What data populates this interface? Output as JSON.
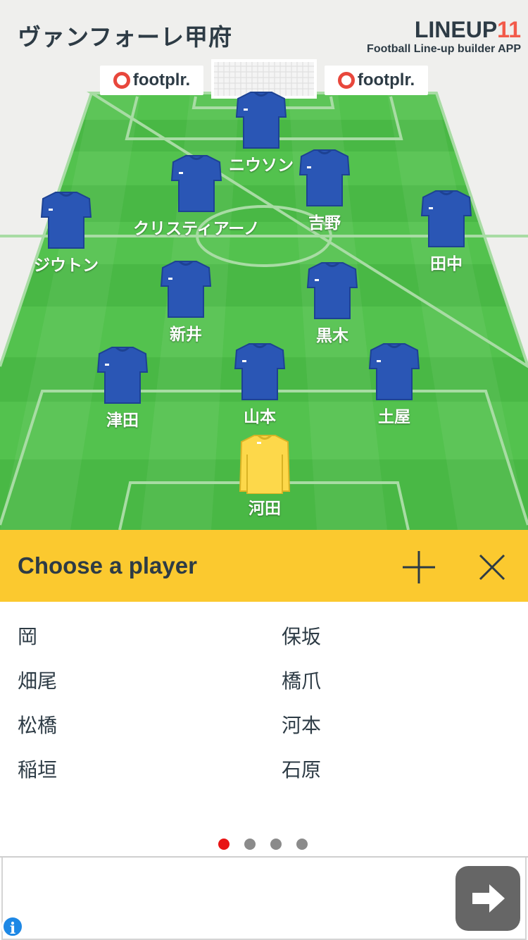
{
  "header": {
    "team_name": "ヴァンフォーレ甲府",
    "brand_logo": "LINEUP",
    "brand_logo_num": "11",
    "brand_sub": "Football Line-up builder APP"
  },
  "sponsors": [
    {
      "text": "footplr."
    },
    {
      "text": "footplr."
    }
  ],
  "pitch": {
    "field_player_shirt_color": "#2a56b5",
    "goalkeeper_shirt_color": "#fdd84a",
    "players": [
      {
        "name": "ニウソン",
        "role": "field"
      },
      {
        "name": "クリスティアーノ",
        "role": "field"
      },
      {
        "name": "吉野",
        "role": "field"
      },
      {
        "name": "ジウトン",
        "role": "field"
      },
      {
        "name": "田中",
        "role": "field"
      },
      {
        "name": "新井",
        "role": "field"
      },
      {
        "name": "黒木",
        "role": "field"
      },
      {
        "name": "津田",
        "role": "field"
      },
      {
        "name": "山本",
        "role": "field"
      },
      {
        "name": "土屋",
        "role": "field"
      },
      {
        "name": "河田",
        "role": "goalkeeper"
      }
    ]
  },
  "chooser": {
    "title": "Choose a player",
    "add_icon": "plus-icon",
    "close_icon": "close-icon",
    "accent": "#fbc92f"
  },
  "player_list": [
    {
      "left": "岡",
      "right": "保坂"
    },
    {
      "left": "畑尾",
      "right": "橋爪"
    },
    {
      "left": "松橋",
      "right": "河本"
    },
    {
      "left": "稲垣",
      "right": "石原"
    }
  ],
  "pagination": {
    "pages": 4,
    "current": 1
  },
  "input": {
    "value": "",
    "placeholder": ""
  }
}
